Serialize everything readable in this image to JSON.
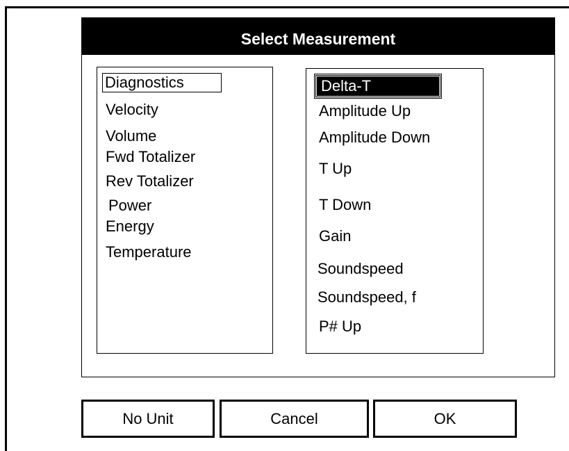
{
  "dialog": {
    "title": "Select Measurement"
  },
  "left_list": {
    "items": [
      "Diagnostics",
      "Velocity",
      "Volume",
      "Fwd Totalizer",
      "Rev Totalizer",
      "Power",
      "Energy",
      "Temperature"
    ],
    "focused": "Diagnostics"
  },
  "right_list": {
    "items": [
      "Delta-T",
      "Amplitude Up",
      "Amplitude Down",
      "T Up",
      "T Down",
      "Gain",
      "Soundspeed",
      "Soundspeed, f",
      "P# Up"
    ],
    "selected": "Delta-T"
  },
  "buttons": {
    "no_unit": "No Unit",
    "cancel": "Cancel",
    "ok": "OK"
  },
  "colors": {
    "highlight_bg": "#000000",
    "highlight_fg": "#ffffff",
    "titlebar_bg": "#000000"
  }
}
